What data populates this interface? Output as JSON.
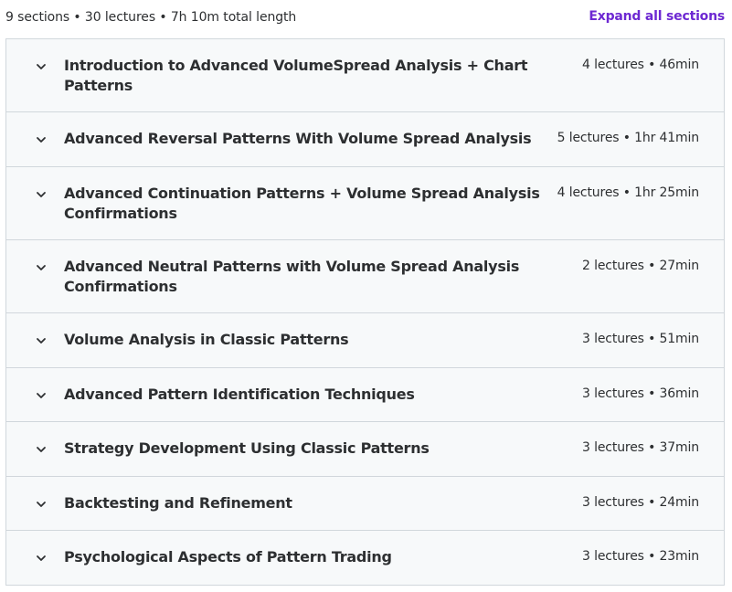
{
  "header": {
    "summary": "9 sections • 30 lectures • 7h 10m total length",
    "expand_all_label": "Expand all sections"
  },
  "colors": {
    "accent": "#6d28d2",
    "section_bg": "#f7f9fa",
    "border": "#d1d7dc",
    "text": "#2d2f31"
  },
  "sections": [
    {
      "title": "Introduction to Advanced VolumeSpread Analysis + Chart Patterns",
      "meta": "4 lectures • 46min",
      "icon": "chevron-down-icon"
    },
    {
      "title": "Advanced Reversal Patterns With Volume Spread Analysis",
      "meta": "5 lectures • 1hr 41min",
      "icon": "chevron-down-icon"
    },
    {
      "title": "Advanced Continuation Patterns + Volume Spread Analysis Confirmations",
      "meta": "4 lectures • 1hr 25min",
      "icon": "chevron-down-icon"
    },
    {
      "title": "Advanced Neutral Patterns with Volume Spread Analysis Confirmations",
      "meta": "2 lectures • 27min",
      "icon": "chevron-down-icon"
    },
    {
      "title": "Volume Analysis in Classic Patterns",
      "meta": "3 lectures • 51min",
      "icon": "chevron-down-icon"
    },
    {
      "title": "Advanced Pattern Identification Techniques",
      "meta": "3 lectures • 36min",
      "icon": "chevron-down-icon"
    },
    {
      "title": "Strategy Development Using Classic Patterns",
      "meta": "3 lectures • 37min",
      "icon": "chevron-down-icon"
    },
    {
      "title": "Backtesting and Refinement",
      "meta": "3 lectures • 24min",
      "icon": "chevron-down-icon"
    },
    {
      "title": "Psychological Aspects of Pattern Trading",
      "meta": "3 lectures • 23min",
      "icon": "chevron-down-icon"
    }
  ]
}
